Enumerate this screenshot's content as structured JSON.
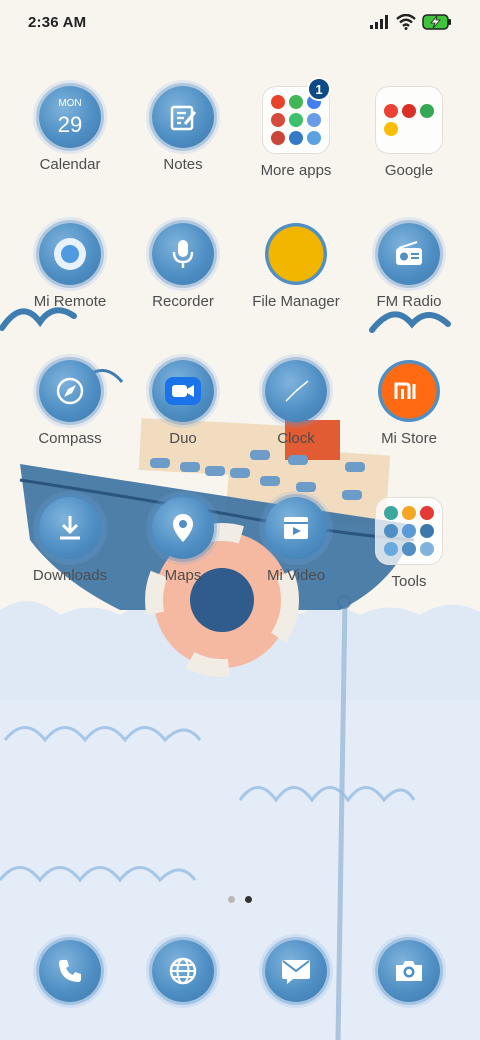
{
  "status_bar": {
    "time": "2:36 AM",
    "icons": [
      "signal-icon",
      "wifi-icon",
      "battery-charging-icon"
    ]
  },
  "calendar_icon": {
    "weekday": "MON",
    "day": "29"
  },
  "apps": {
    "calendar": "Calendar",
    "notes": "Notes",
    "more_apps": "More apps",
    "google": "Google",
    "mi_remote": "Mi Remote",
    "recorder": "Recorder",
    "file_manager": "File Manager",
    "fm_radio": "FM Radio",
    "compass": "Compass",
    "duo": "Duo",
    "clock": "Clock",
    "mi_store": "Mi Store",
    "downloads": "Downloads",
    "maps": "Maps",
    "mi_video": "Mi Video",
    "tools": "Tools"
  },
  "more_apps_badge": "1",
  "dock": [
    "phone-icon",
    "browser-icon",
    "messages-icon",
    "camera-icon"
  ],
  "page_indicator": {
    "pages": 2,
    "current": 2
  },
  "colors": {
    "blob_blue": "#4f8fc4",
    "badge": "#0c4b86",
    "mi_orange": "#ff6a13",
    "file_yellow": "#f2b500"
  }
}
